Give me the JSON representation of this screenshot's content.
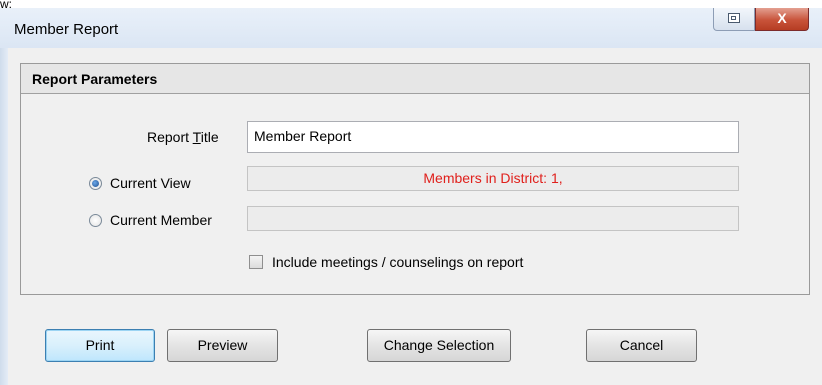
{
  "window": {
    "title": "Member Report"
  },
  "crop_text": "w:",
  "parameters": {
    "header": "Report Parameters",
    "report_title_label_pre": "Report ",
    "report_title_label_mnemonic": "T",
    "report_title_label_post": "itle",
    "report_title_value": "Member Report",
    "current_view_label": "Current View",
    "current_view_value": "Members in District: 1,",
    "current_view_selected": true,
    "current_member_label": "Current Member",
    "current_member_value": "",
    "include_label": "Include meetings / counselings on report",
    "include_checked": false
  },
  "buttons": {
    "print": "Print",
    "preview": "Preview",
    "change_selection": "Change Selection",
    "cancel": "Cancel",
    "close_glyph": "X"
  },
  "colors": {
    "highlight_text": "#e0201c",
    "default_button_border": "#3c7fb1"
  }
}
